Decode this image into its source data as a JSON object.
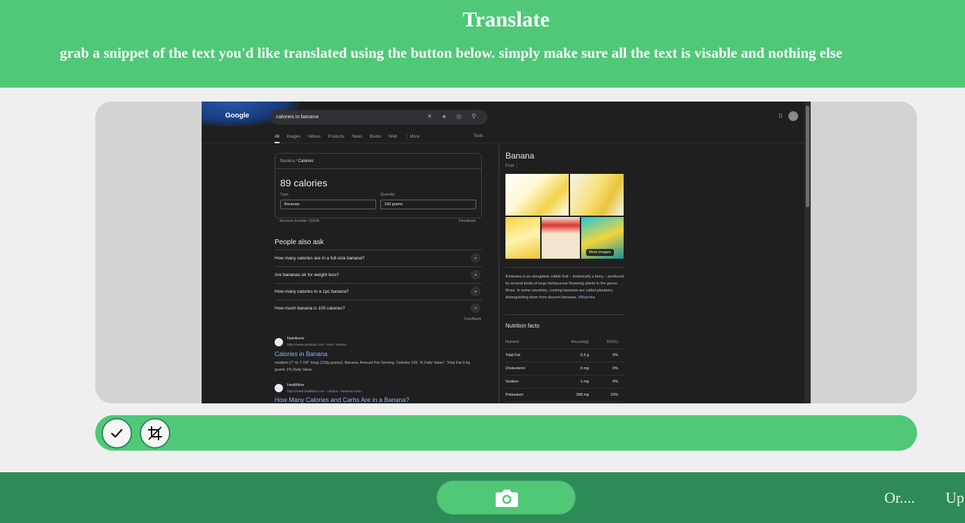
{
  "header": {
    "title": "Translate",
    "subtitle": "grab a snippet of the text you'd like translated using the button below. simply make sure all the text is visable and nothing else"
  },
  "preview": {
    "search_query": "calories in banana",
    "doodle_text": "Google",
    "tabs": [
      "All",
      "Images",
      "Videos",
      "Products",
      "News",
      "Books",
      "Web",
      "⋮ More"
    ],
    "tools_label": "Tools",
    "calorie_card": {
      "crumb_a": "Banana",
      "crumb_sep": "/",
      "crumb_b": "Calories",
      "value": "89 calories",
      "type_label": "Type",
      "type_value": "Bananas",
      "quantity_label": "Quantity",
      "quantity_value": "100 grams",
      "source": "Sources include: USDA",
      "feedback": "Feedback"
    },
    "people_also_ask": {
      "title": "People also ask",
      "questions": [
        "How many calories are in a full-size banana?",
        "Are bananas ok for weight loss?",
        "How many calories in a 1pc banana?",
        "How much banana is 100 calories?"
      ],
      "feedback": "Feedback"
    },
    "results": [
      {
        "site": "Nutritionix",
        "url": "https://www.nutritionix.com › food › banana",
        "title": "Calories in Banana",
        "snippet": "medium (7\" to 7-7/8\" long) (118g grams). Banana. Amount Per Serving. Calories 105. % Daily Value*. Total Fat 0.4g grams 1% Daily Value."
      },
      {
        "site": "Healthline",
        "url": "https://www.healthline.com › nutrition › bananas-calori...",
        "title": "How Many Calories and Carbs Are in a Banana?",
        "snippet": ""
      }
    ],
    "knowledge_panel": {
      "title": "Banana",
      "subtitle": "Fruit ⋮",
      "more_images": "More images",
      "description": "A banana is an elongated, edible fruit – botanically a berry – produced by several kinds of large herbaceous flowering plants in the genus Musa. In some countries, cooking bananas are called plantains, distinguishing them from dessert bananas.",
      "description_link": "Wikipedia",
      "nutrition_title": "Nutrition facts",
      "nutrition_headers": [
        "Nutrient",
        "Amount(g)",
        "DV(%)"
      ],
      "nutrition_rows": [
        [
          "Total Fat",
          "0.3 g",
          "0%"
        ],
        [
          "Cholesterol",
          "0 mg",
          "0%"
        ],
        [
          "Sodium",
          "1 mg",
          "0%"
        ],
        [
          "Potassium",
          "358 mg",
          "10%"
        ]
      ]
    }
  },
  "toolbar": {
    "confirm_icon": "check-icon",
    "crop_icon": "crop-icon"
  },
  "footer": {
    "camera_icon": "camera-icon",
    "or_text": "Or....",
    "upload_text": "Up"
  },
  "colors": {
    "primary_green": "#50c878",
    "dark_green": "#2e8b57",
    "background": "#efefef",
    "preview_bg": "#d3d3d3"
  }
}
